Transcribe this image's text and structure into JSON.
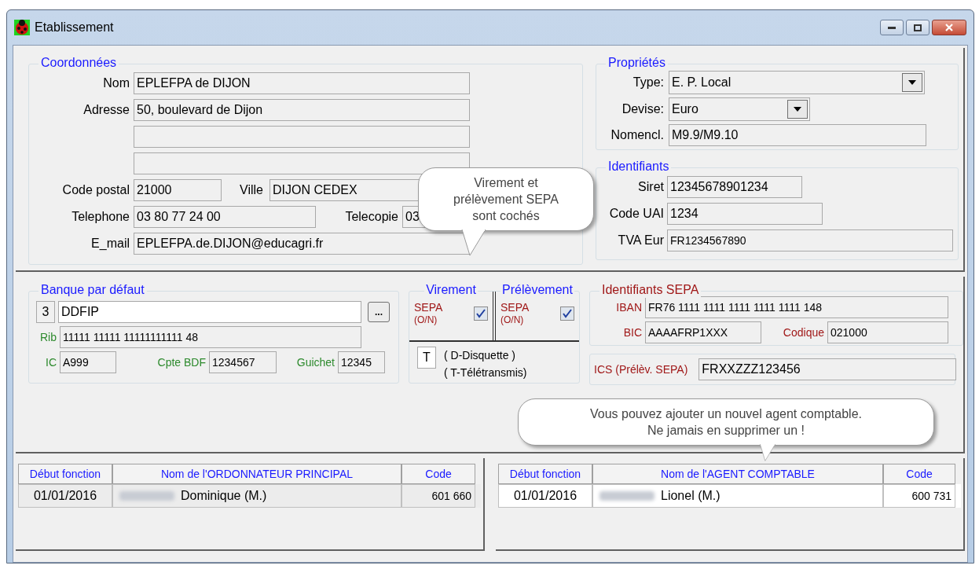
{
  "window": {
    "title": "Etablissement"
  },
  "coordonnees": {
    "title": "Coordonnées",
    "nom": {
      "label": "Nom",
      "value": "EPLEFPA de DIJON"
    },
    "adresse": {
      "label": "Adresse",
      "value": "50, boulevard de Dijon"
    },
    "code_postal": {
      "label": "Code postal",
      "value": "21000"
    },
    "ville": {
      "label": "Ville",
      "value": "DIJON CEDEX"
    },
    "telephone": {
      "label": "Telephone",
      "value": "03 80 77 24 00"
    },
    "telecopie": {
      "label": "Telecopie",
      "value": "03"
    },
    "email": {
      "label": "E_mail",
      "value": "EPLEFPA.de.DIJON@educagri.fr"
    }
  },
  "proprietes": {
    "title": "Propriétés",
    "fields": [
      {
        "kind": "dropdown",
        "label": "Type:",
        "value": "E. P. Local"
      },
      {
        "kind": "dropdown",
        "label": "Devise:",
        "value": "Euro"
      },
      {
        "kind": "text",
        "label": "Nomencl.",
        "value": "M9.9/M9.10"
      }
    ]
  },
  "identifiants": {
    "title": "Identifiants",
    "fields": [
      {
        "label": "Siret",
        "value": "12345678901234"
      },
      {
        "label": "Code UAI",
        "value": "1234"
      },
      {
        "label": "TVA Eur",
        "value": "FR1234567890"
      }
    ]
  },
  "banque": {
    "title": "Banque par défaut",
    "number": "3",
    "name": "DDFIP",
    "browse": "...",
    "rib": {
      "label": "Rib",
      "value": "11111 11111 11111111111 48"
    },
    "ic": {
      "label": "IC",
      "value": "A999"
    },
    "cpte_bdf": {
      "label": "Cpte BDF",
      "value": "1234567"
    },
    "guichet": {
      "label": "Guichet",
      "value": "12345"
    }
  },
  "modes": [
    {
      "title": "Virement",
      "label": "SEPA",
      "sub": "(O/N)",
      "checked": true
    },
    {
      "title": "Prélèvement",
      "label": "SEPA",
      "sub": "(O/N)",
      "checked": true
    }
  ],
  "transmission": {
    "value": "T",
    "options": [
      "( D-Disquette )",
      "( T-Télétransmis)"
    ]
  },
  "sepa": {
    "title": "Identifiants SEPA",
    "iban": {
      "label": "IBAN",
      "value": "FR76 1111 1111 1111 1111 1111 148"
    },
    "bic": {
      "label": "BIC",
      "value": "AAAAFRP1XXX"
    },
    "codique": {
      "label": "Codique",
      "value": "021000"
    },
    "ics": {
      "label": "ICS (Prélèv. SEPA)",
      "value": "FRXXZZZ123456"
    }
  },
  "tables": [
    {
      "columns": [
        "Début fonction",
        "Nom de l'ORDONNATEUR PRINCIPAL",
        "Code"
      ],
      "rows": [
        {
          "date": "01/01/2016",
          "name": "Dominique (M.)",
          "code": "601 660",
          "selected": false
        }
      ]
    },
    {
      "columns": [
        "Début fonction",
        "Nom de l'AGENT COMPTABLE",
        "Code"
      ],
      "rows": [
        {
          "date": "01/01/2016",
          "name": "Lionel (M.)",
          "code": "600 731",
          "selected": true
        }
      ]
    }
  ],
  "callouts": [
    {
      "lines": [
        "Virement et",
        "prélèvement SEPA",
        "sont cochés"
      ]
    },
    {
      "lines": [
        "Vous pouvez ajouter un nouvel agent comptable.",
        "Ne jamais en supprimer un !"
      ]
    }
  ]
}
